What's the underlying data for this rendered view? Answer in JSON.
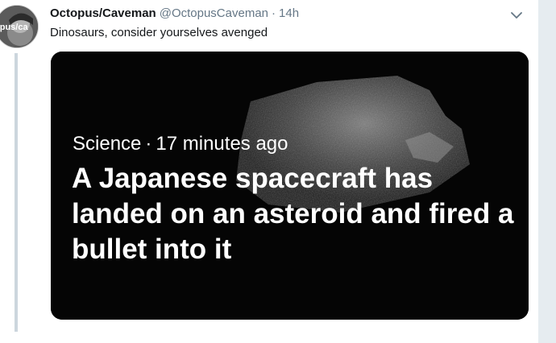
{
  "tweet": {
    "author": {
      "display_name": "Octopus/Caveman",
      "handle": "@OctopusCaveman",
      "avatar_text": "opus/ca"
    },
    "separator": "·",
    "time": "14h",
    "text": "Dinosaurs, consider yourselves avenged",
    "menu_icon": "chevron-down-icon"
  },
  "card": {
    "category": "Science",
    "separator": "·",
    "age": "17 minutes ago",
    "headline": "A Japanese spacecraft has landed on an asteroid and fired a bullet into it"
  },
  "colors": {
    "name": "#14171a",
    "secondary": "#657786",
    "thread_line": "#ccd6dd",
    "card_background": "#050505",
    "card_text": "#ffffff"
  }
}
